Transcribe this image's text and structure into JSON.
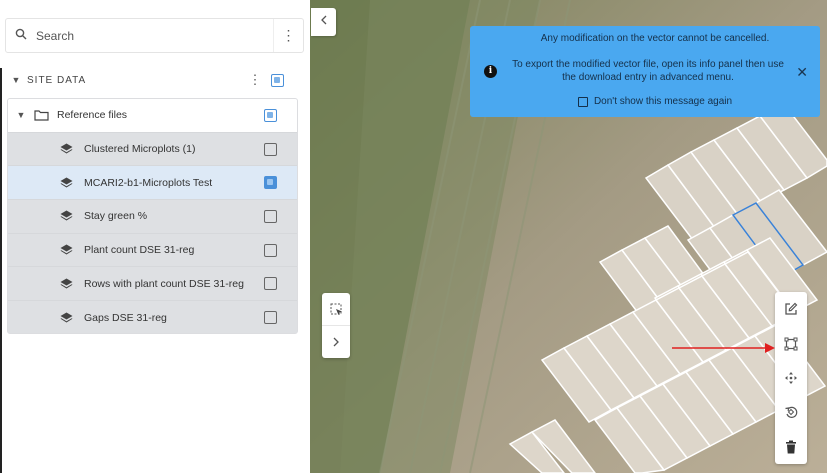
{
  "search": {
    "placeholder": "Search",
    "icon": "search-icon"
  },
  "site_data": {
    "label": "SITE DATA"
  },
  "tree": {
    "folder": {
      "label": "Reference files"
    },
    "layers": [
      {
        "label": "Clustered Microplots (1)",
        "checked": false,
        "selected": false
      },
      {
        "label": "MCARI2-b1-Microplots Test",
        "checked": true,
        "selected": true
      },
      {
        "label": "Stay green %",
        "checked": false,
        "selected": false
      },
      {
        "label": "Plant count DSE 31-reg",
        "checked": false,
        "selected": false
      },
      {
        "label": "Rows with plant count DSE 31-reg",
        "checked": false,
        "selected": false
      },
      {
        "label": "Gaps DSE 31-reg",
        "checked": false,
        "selected": false
      }
    ]
  },
  "banner": {
    "line1": "Any modification on the vector cannot be cancelled.",
    "line2": "To export the modified vector file, open its info panel then use the download entry in advanced menu.",
    "dont_show": "Don't show this message again",
    "color": "#4aa8f0"
  },
  "map_tools": [
    "box-select-icon",
    "chevron-right-icon"
  ],
  "edit_tools": [
    "edit-icon",
    "bounding-box-icon",
    "move-icon",
    "rotate-icon",
    "delete-icon"
  ],
  "colors": {
    "selection": "#4a90d9",
    "arrow": "#e02020"
  }
}
